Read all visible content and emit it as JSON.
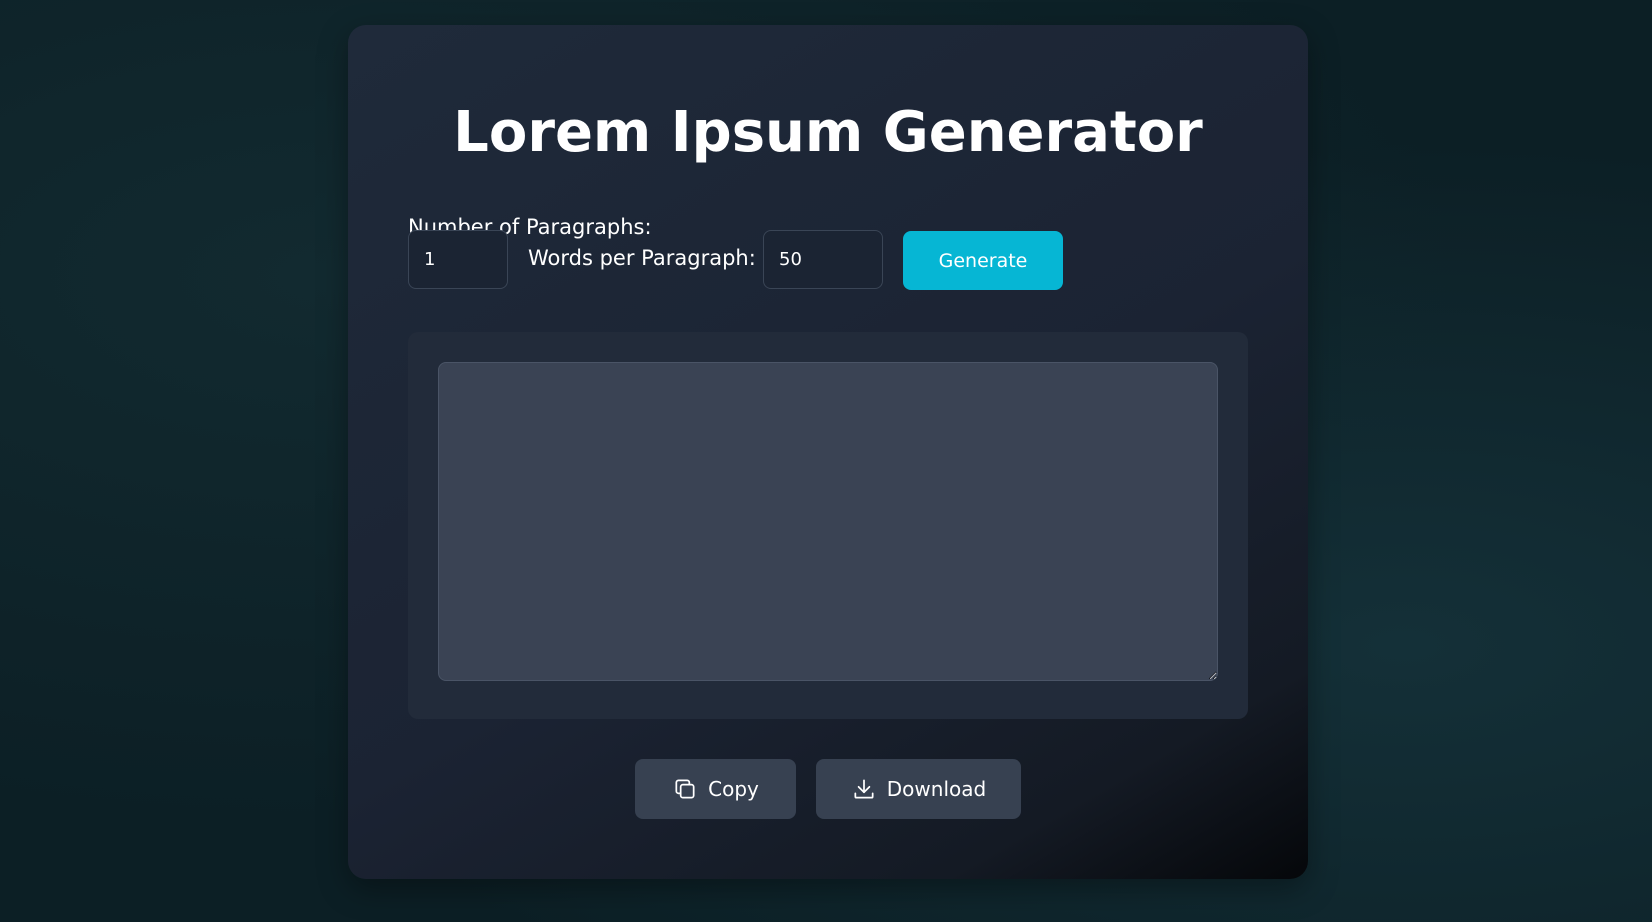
{
  "app": {
    "title": "Lorem Ipsum Generator"
  },
  "controls": {
    "paragraphs_label": "Number of Paragraphs:",
    "paragraphs_value": "1",
    "words_label": "Words per Paragraph:",
    "words_value": "50",
    "generate_label": "Generate"
  },
  "output": {
    "text": ""
  },
  "actions": {
    "copy_label": "Copy",
    "copy_icon": "copy-icon",
    "download_label": "Download",
    "download_icon": "download-icon"
  },
  "colors": {
    "accent": "#06b6d4",
    "card": "#1f2937",
    "button": "#374151",
    "textarea": "#3a4354"
  }
}
